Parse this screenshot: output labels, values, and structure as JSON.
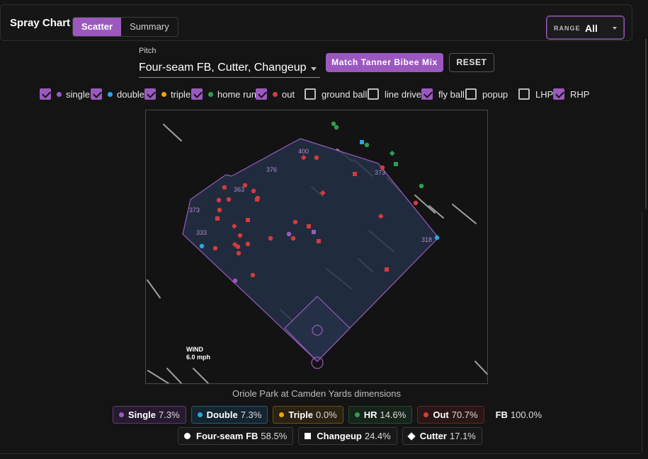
{
  "header": {
    "title": "Spray Chart",
    "tabs": [
      {
        "label": "Scatter",
        "active": true
      },
      {
        "label": "Summary",
        "active": false
      }
    ],
    "range_label": "RANGE",
    "range_value": "All"
  },
  "pitch_filter": {
    "label": "Pitch",
    "value": "Four-seam FB, Cutter, Changeup",
    "match_button": "Match Tanner Bibee Mix",
    "reset_button": "RESET"
  },
  "filters": [
    {
      "label": "single",
      "checked": true,
      "dot": "#9b59c0"
    },
    {
      "label": "double",
      "checked": true,
      "dot": "#29a8e0"
    },
    {
      "label": "triple",
      "checked": true,
      "dot": "#f0a500"
    },
    {
      "label": "home run",
      "checked": true,
      "dot": "#2e9e4f"
    },
    {
      "label": "out",
      "checked": true,
      "dot": "#d33c3c"
    },
    {
      "label": "ground ball",
      "checked": false
    },
    {
      "label": "line drive",
      "checked": false
    },
    {
      "label": "fly ball",
      "checked": true
    },
    {
      "label": "popup",
      "checked": false
    },
    {
      "label": "LHP",
      "checked": false
    },
    {
      "label": "RHP",
      "checked": true
    }
  ],
  "field": {
    "distances": [
      "400",
      "376",
      "373",
      "363",
      "373",
      "333",
      "318"
    ],
    "wind_label": "WIND",
    "wind_speed": "6.0 mph",
    "caption": "Oriole Park at Camden Yards dimensions"
  },
  "results_legend": [
    {
      "name": "Single",
      "pct": "7.3%",
      "color": "#9b59c0"
    },
    {
      "name": "Double",
      "pct": "7.3%",
      "color": "#29a8e0"
    },
    {
      "name": "Triple",
      "pct": "0.0%",
      "color": "#f0a500"
    },
    {
      "name": "HR",
      "pct": "14.6%",
      "color": "#2e9e4f"
    },
    {
      "name": "Out",
      "pct": "70.7%",
      "color": "#d33c3c"
    },
    {
      "name": "FB",
      "pct": "100.0%"
    }
  ],
  "pitch_legend": [
    {
      "name": "Four-seam FB",
      "pct": "58.5%",
      "shape": "circle"
    },
    {
      "name": "Changeup",
      "pct": "24.4%",
      "shape": "square"
    },
    {
      "name": "Cutter",
      "pct": "17.1%",
      "shape": "diamond"
    }
  ],
  "colors": {
    "accent": "#9b59c0",
    "single": "#9b59c0",
    "double": "#29a8e0",
    "triple": "#f0a500",
    "home_run": "#2e9e4f",
    "out": "#d33c3c"
  }
}
